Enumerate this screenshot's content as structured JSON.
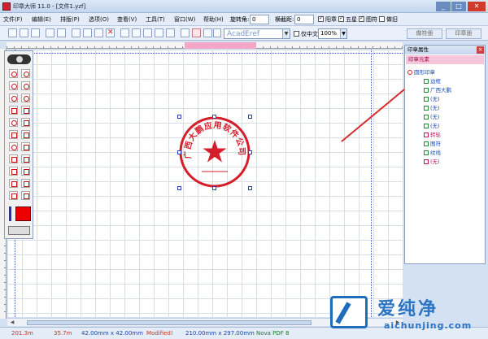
{
  "window": {
    "title": "印章大师 11.0 - [文件1.yzf]",
    "controls": [
      "_",
      "□",
      "✕"
    ]
  },
  "menu": {
    "items": [
      "文件(F)",
      "编辑(E)",
      "排版(P)",
      "选项(O)",
      "查看(V)",
      "工具(T)",
      "窗口(W)",
      "帮助(H)"
    ],
    "rotation_label": "旋转角:",
    "rotation_value": "0",
    "spacing_label": "横截距:",
    "spacing_value": "0",
    "checks": [
      {
        "label": "阳章",
        "checked": true
      },
      {
        "label": "五星",
        "checked": true
      },
      {
        "label": "图符",
        "checked": true
      },
      {
        "label": "做旧",
        "checked": false
      }
    ]
  },
  "toolbar": {
    "font": "AcadEref",
    "chinese_only_label": "仅中文",
    "zoom": "100%",
    "right_buttons": [
      "做符册",
      "印章册"
    ]
  },
  "stamp": {
    "text": "广西大鹏应用软件公司",
    "color": "#d41f2b"
  },
  "panel": {
    "title": "印章属性",
    "section": "印章元素",
    "tree": [
      {
        "label": "圆形印章",
        "level": 0,
        "kind": "root"
      },
      {
        "label": "边框",
        "level": 1,
        "kind": "item"
      },
      {
        "label": "广西大鹏",
        "level": 1,
        "kind": "item"
      },
      {
        "label": "(无)",
        "level": 1,
        "kind": "item"
      },
      {
        "label": "(无)",
        "level": 1,
        "kind": "item"
      },
      {
        "label": "(无)",
        "level": 1,
        "kind": "item"
      },
      {
        "label": "(无)",
        "level": 1,
        "kind": "item"
      },
      {
        "label": "转轮",
        "level": 1,
        "kind": "pink"
      },
      {
        "label": "图符",
        "level": 1,
        "kind": "item"
      },
      {
        "label": "纹线",
        "level": 1,
        "kind": "item"
      },
      {
        "label": "(无)",
        "level": 1,
        "kind": "pink"
      }
    ]
  },
  "status": {
    "value_a": "201.3m",
    "value_b": "35.7m",
    "size": "42.00mm x 42.00mm",
    "modified": "Modified!",
    "paper": "210.00mm x 297.00mm",
    "printer": "Nova PDF 8"
  },
  "watermark": {
    "brand": "爱纯净",
    "url": "aichunjing.com"
  },
  "colors": {
    "stamp_red": "#d41f2b",
    "guide_blue": "#3a55c8",
    "highlight_pink": "#f4a6c8"
  }
}
